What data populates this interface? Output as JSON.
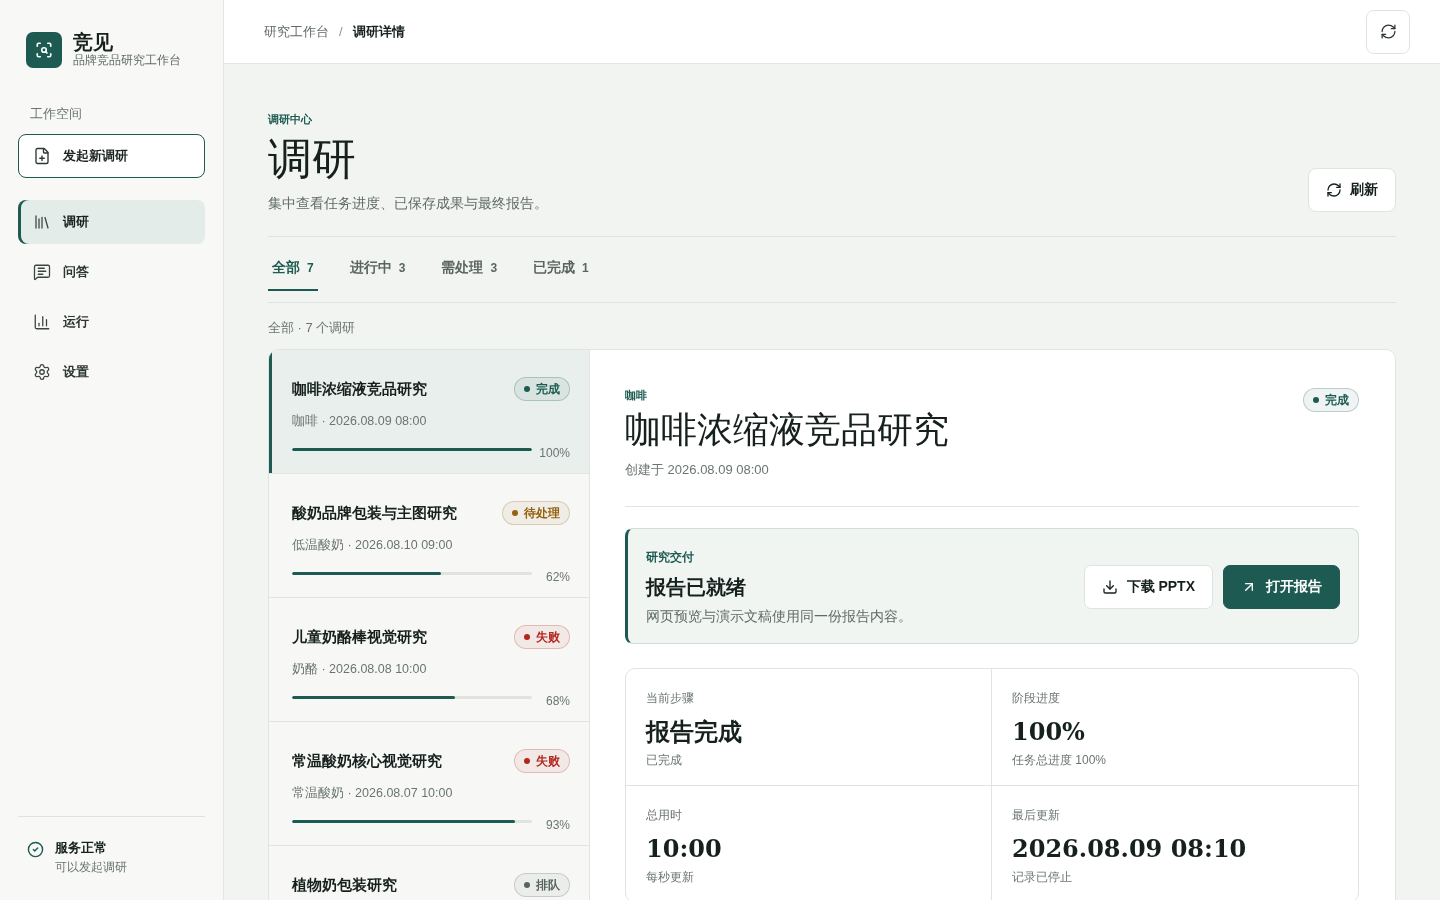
{
  "sidebar": {
    "brand": {
      "name": "竞见",
      "tagline": "品牌竞品研究工作台"
    },
    "section_label": "工作空间",
    "new_button": "发起新调研",
    "nav_items": [
      {
        "label": "调研",
        "selected": true
      },
      {
        "label": "问答",
        "selected": false
      },
      {
        "label": "运行",
        "selected": false
      },
      {
        "label": "设置",
        "selected": false
      }
    ],
    "status": {
      "title": "服务正常",
      "subtitle": "可以发起调研"
    }
  },
  "header": {
    "breadcrumb": [
      {
        "label": "研究工作台",
        "current": false
      },
      {
        "label": "调研详情",
        "current": true
      }
    ],
    "separator": "/"
  },
  "page": {
    "eyebrow": "调研中心",
    "title": "调研",
    "description": "集中查看任务进度、已保存成果与最终报告。",
    "refresh_button": "刷新"
  },
  "tabs": [
    {
      "label": "全部",
      "count": "7",
      "selected": true
    },
    {
      "label": "进行中",
      "count": "3",
      "selected": false
    },
    {
      "label": "需处理",
      "count": "3",
      "selected": false
    },
    {
      "label": "已完成",
      "count": "1",
      "selected": false
    }
  ],
  "list_summary": "全部 · 7 个调研",
  "studies": [
    {
      "title": "咖啡浓缩液竞品研究",
      "status": "完成",
      "color": "#1d5b52",
      "meta": "咖啡 · 2026.08.09 08:00",
      "level": 1,
      "percent": "100%",
      "selected": true
    },
    {
      "title": "酸奶品牌包装与主图研究",
      "status": "待处理",
      "color": "#94620f",
      "meta": "低温酸奶 · 2026.08.10 09:00",
      "level": 0.62,
      "percent": "62%",
      "selected": false
    },
    {
      "title": "儿童奶酪棒视觉研究",
      "status": "失败",
      "color": "#b3261e",
      "meta": "奶酪 · 2026.08.08 10:00",
      "level": 0.68,
      "percent": "68%",
      "selected": false
    },
    {
      "title": "常温酸奶核心视觉研究",
      "status": "失败",
      "color": "#b3261e",
      "meta": "常温酸奶 · 2026.08.07 10:00",
      "level": 0.93,
      "percent": "93%",
      "selected": false
    },
    {
      "title": "植物奶包装研究",
      "status": "排队",
      "color": "#56635f",
      "selected": false
    }
  ],
  "detail": {
    "category": "咖啡",
    "status": {
      "label": "完成",
      "color": "#1d5b52"
    },
    "title": "咖啡浓缩液竞品研究",
    "created": "创建于 2026.08.09 08:00",
    "delivery": {
      "eyebrow": "研究交付",
      "title": "报告已就绪",
      "description": "网页预览与演示文稿使用同一份报告内容。",
      "buttons": [
        {
          "label": "下载 PPTX",
          "kind": "secondary"
        },
        {
          "label": "打开报告",
          "kind": "primary"
        }
      ]
    },
    "stats": [
      {
        "label": "当前步骤",
        "value": "报告完成",
        "note": "已完成"
      },
      {
        "label": "阶段进度",
        "value": "100%",
        "note": "任务总进度 100%"
      },
      {
        "label": "总用时",
        "value": "10:00",
        "note": "每秒更新"
      },
      {
        "label": "最后更新",
        "value": "2026.08.09 08:10",
        "note": "记录已停止"
      }
    ]
  }
}
